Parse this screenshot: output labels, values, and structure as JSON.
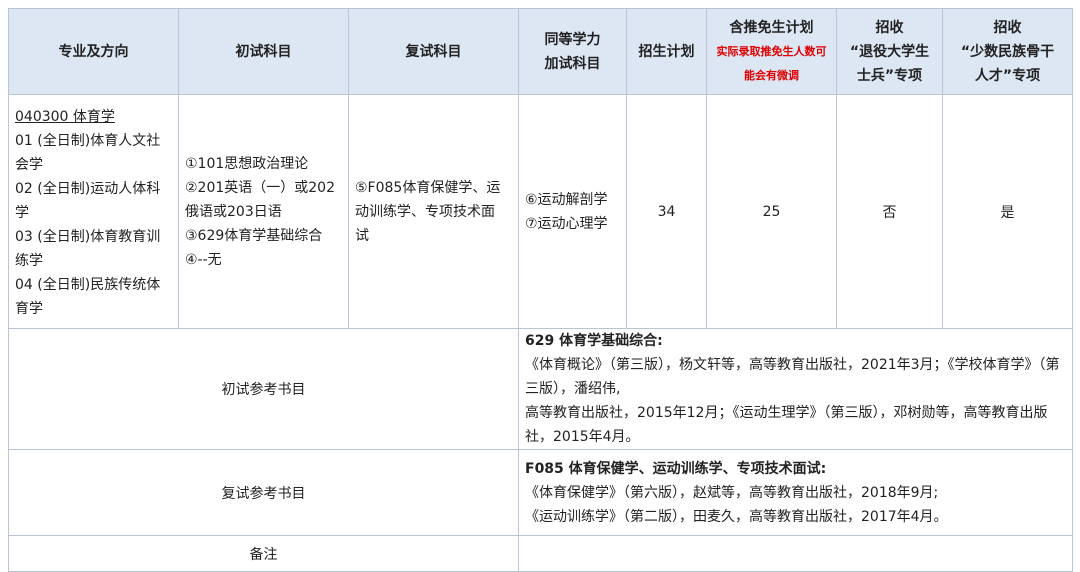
{
  "headers": {
    "major": "专业及方向",
    "initial": "初试科目",
    "retest": "复试科目",
    "equiv_line1": "同等学力",
    "equiv_line2": "加试科目",
    "plan": "招生计划",
    "exempt_title": "含推免生计划",
    "exempt_note_line1": "实际录取推免生人数可",
    "exempt_note_line2": "能会有微调",
    "veteran_line1": "招收",
    "veteran_line2": "“退役大学生",
    "veteran_line3": "士兵”专项",
    "minority_line1": "招收",
    "minority_line2": "“少数民族骨干",
    "minority_line3": "人才”专项"
  },
  "row": {
    "major_code": "040300 体育学",
    "directions": [
      "01 (全日制)体育人文社",
      "会学",
      "02 (全日制)运动人体科",
      "学",
      "03 (全日制)体育教育训",
      "练学",
      "04 (全日制)民族传统体",
      "育学"
    ],
    "initial": [
      "①101思想政治理论",
      "②201英语（一）或202",
      "俄语或203日语",
      "③629体育学基础综合",
      "④--无"
    ],
    "retest": [
      "⑤F085体育保健学、运",
      "动训练学、专项技术面",
      "试"
    ],
    "equiv": [
      "⑥运动解剖学",
      "⑦运动心理学"
    ],
    "plan": "34",
    "exempt": "25",
    "veteran": "否",
    "minority": "是"
  },
  "initial_refs": {
    "label": "初试参考书目",
    "title": "629 体育学基础综合:",
    "lines": [
      "《体育概论》（第三版），杨文轩等，高等教育出版社，2021年3月；《学校体育学》（第三版），潘绍伟,",
      "高等教育出版社，2015年12月；《运动生理学》（第三版），邓树勋等，高等教育出版社，2015年4月。"
    ]
  },
  "retest_refs": {
    "label": "复试参考书目",
    "title": "F085 体育保健学、运动训练学、专项技术面试:",
    "lines": [
      "《体育保健学》（第六版），赵斌等，高等教育出版社，2018年9月;",
      "《运动训练学》（第二版），田麦久，高等教育出版社，2017年4月。"
    ]
  },
  "remarks": {
    "label": "备注",
    "value": ""
  }
}
